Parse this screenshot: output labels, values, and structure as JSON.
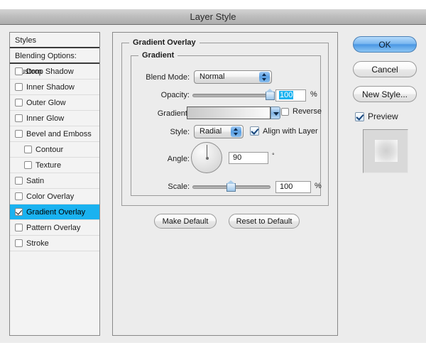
{
  "window": {
    "title": "Layer Style"
  },
  "sidebar": {
    "header": "Styles",
    "blending_options": "Blending Options: Custom",
    "items": [
      {
        "label": "Drop Shadow",
        "checked": false,
        "indent": false,
        "selected": false
      },
      {
        "label": "Inner Shadow",
        "checked": false,
        "indent": false,
        "selected": false
      },
      {
        "label": "Outer Glow",
        "checked": false,
        "indent": false,
        "selected": false
      },
      {
        "label": "Inner Glow",
        "checked": false,
        "indent": false,
        "selected": false
      },
      {
        "label": "Bevel and Emboss",
        "checked": false,
        "indent": false,
        "selected": false
      },
      {
        "label": "Contour",
        "checked": false,
        "indent": true,
        "selected": false
      },
      {
        "label": "Texture",
        "checked": false,
        "indent": true,
        "selected": false
      },
      {
        "label": "Satin",
        "checked": false,
        "indent": false,
        "selected": false
      },
      {
        "label": "Color Overlay",
        "checked": false,
        "indent": false,
        "selected": false
      },
      {
        "label": "Gradient Overlay",
        "checked": true,
        "indent": false,
        "selected": true
      },
      {
        "label": "Pattern Overlay",
        "checked": false,
        "indent": false,
        "selected": false
      },
      {
        "label": "Stroke",
        "checked": false,
        "indent": false,
        "selected": false
      }
    ]
  },
  "main": {
    "section_title": "Gradient Overlay",
    "group_title": "Gradient",
    "blend_mode": {
      "label": "Blend Mode:",
      "value": "Normal"
    },
    "opacity": {
      "label": "Opacity:",
      "value": "100",
      "unit": "%",
      "percent": 100
    },
    "gradient": {
      "label": "Gradient:",
      "reverse_label": "Reverse",
      "reverse_checked": false
    },
    "style": {
      "label": "Style:",
      "value": "Radial",
      "align_label": "Align with Layer",
      "align_checked": true
    },
    "angle": {
      "label": "Angle:",
      "value": "90",
      "unit": "°",
      "degrees": 90
    },
    "scale": {
      "label": "Scale:",
      "value": "100",
      "unit": "%",
      "percent": 50
    },
    "make_default": "Make Default",
    "reset_default": "Reset to Default"
  },
  "buttons": {
    "ok": "OK",
    "cancel": "Cancel",
    "new_style": "New Style...",
    "preview_label": "Preview",
    "preview_checked": true
  },
  "colors": {
    "accent": "#1ab2f0",
    "primary_button": "#4a97e4",
    "window_bg": "#ececec",
    "panel_bg": "#f3f3f3"
  }
}
